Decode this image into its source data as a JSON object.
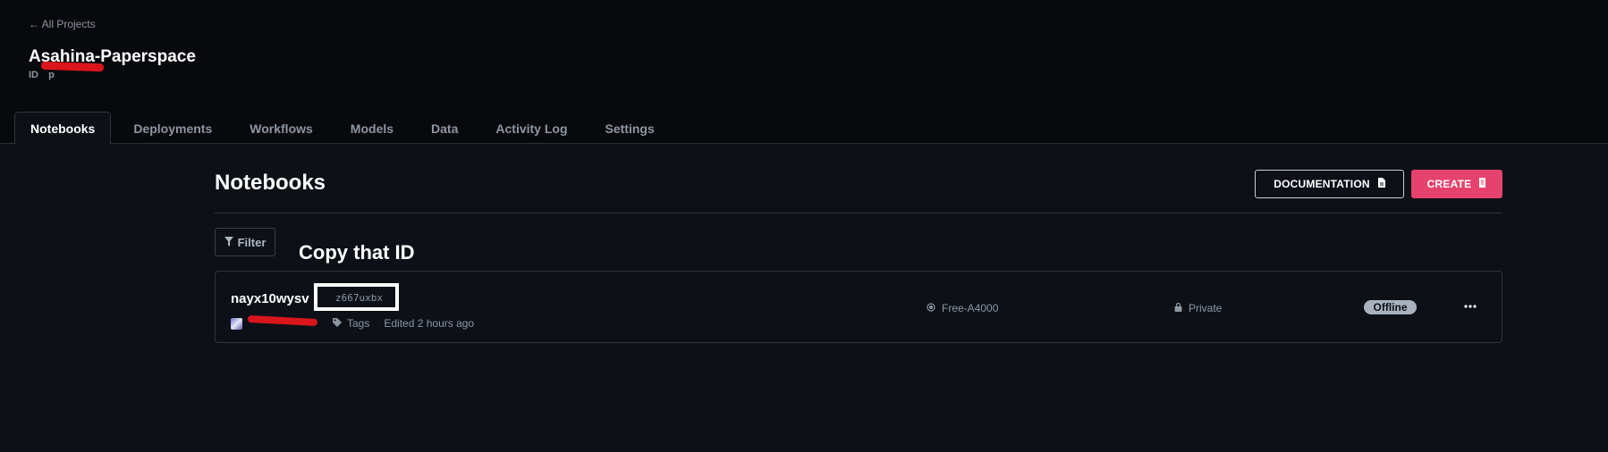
{
  "header": {
    "back_link": "← All Projects",
    "project_title": "Asahina-Paperspace",
    "id_label": "ID",
    "id_value": "p"
  },
  "tabs": [
    {
      "label": "Notebooks",
      "active": true
    },
    {
      "label": "Deployments"
    },
    {
      "label": "Workflows"
    },
    {
      "label": "Models"
    },
    {
      "label": "Data"
    },
    {
      "label": "Activity Log"
    },
    {
      "label": "Settings"
    }
  ],
  "main": {
    "title": "Notebooks",
    "documentation_label": "DOCUMENTATION",
    "create_label": "CREATE",
    "filter_label": "Filter",
    "annotation": "Copy that ID"
  },
  "notebook": {
    "name": "nayx10wysv",
    "id": "z667uxbx",
    "tags_label": "Tags",
    "edited": "Edited 2 hours ago",
    "machine": "Free-A4000",
    "visibility": "Private",
    "status": "Offline"
  },
  "colors": {
    "accent": "#e5436e",
    "redaction": "#d9161c",
    "background": "#0d1117",
    "header_background": "#07090c"
  },
  "icons": [
    "document-icon",
    "create-icon",
    "filter-icon",
    "tag-icon",
    "gpu-icon",
    "lock-icon",
    "more-icon",
    "avatar"
  ]
}
